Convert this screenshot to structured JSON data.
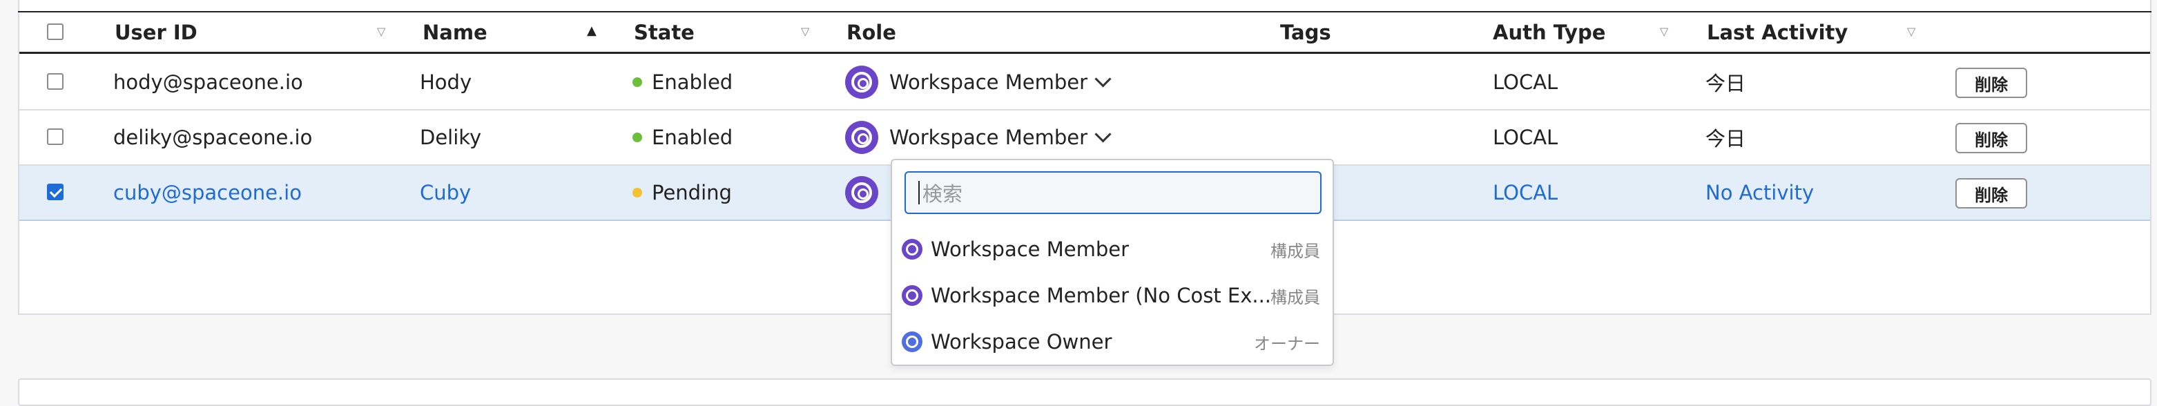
{
  "columns": {
    "user_id": "User ID",
    "name": "Name",
    "state": "State",
    "role": "Role",
    "tags": "Tags",
    "auth_type": "Auth Type",
    "last_activity": "Last Activity"
  },
  "rows": [
    {
      "user_id": "hody@spaceone.io",
      "name": "Hody",
      "state": "Enabled",
      "state_color": "#6cbf3c",
      "role": "Workspace Member",
      "auth_type": "LOCAL",
      "last_activity": "今日",
      "action": "削除",
      "checked": false
    },
    {
      "user_id": "deliky@spaceone.io",
      "name": "Deliky",
      "state": "Enabled",
      "state_color": "#6cbf3c",
      "role": "Workspace Member",
      "auth_type": "LOCAL",
      "last_activity": "今日",
      "action": "削除",
      "checked": false
    },
    {
      "user_id": "cuby@spaceone.io",
      "name": "Cuby",
      "state": "Pending",
      "state_color": "#f2c230",
      "role": "",
      "auth_type": "LOCAL",
      "last_activity": "No Activity",
      "action": "削除",
      "checked": true
    }
  ],
  "role_dropdown": {
    "search_placeholder": "検索",
    "options": [
      {
        "label": "Workspace Member",
        "tag": "構成員",
        "icon": "workspace-member-icon"
      },
      {
        "label": "Workspace Member (No Cost Ex...",
        "tag": "構成員",
        "icon": "workspace-member-icon"
      },
      {
        "label": "Workspace Owner",
        "tag": "オーナー",
        "icon": "workspace-owner-icon"
      }
    ]
  },
  "colors": {
    "accent": "#1e6bd6",
    "role_icon": "#6a44c9",
    "selected_row": "#e4eef9"
  }
}
